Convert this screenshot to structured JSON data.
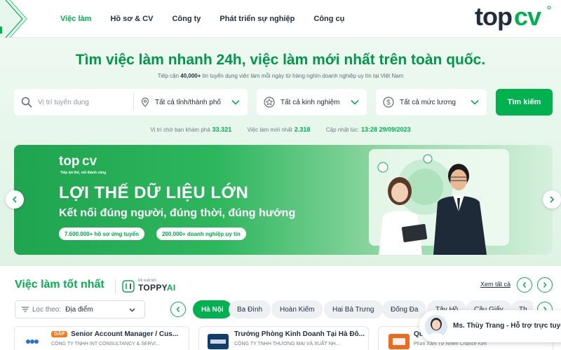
{
  "header": {
    "nav": [
      "Việc làm",
      "Hồ sơ & CV",
      "Công ty",
      "Phát triển sự nghiệp",
      "Công cụ"
    ],
    "logo_text": "topcv"
  },
  "hero": {
    "title": "Tìm việc làm nhanh 24h, việc làm mới nhất trên toàn quốc.",
    "subtitle_prefix": "Tiếp cận",
    "subtitle_count": "40,000+",
    "subtitle_rest": "tin tuyển dụng việc làm mỗi ngày từ hàng nghìn doanh nghiệp uy tín tại Việt Nam",
    "search": {
      "keyword_placeholder": "Vị trí tuyển dụng",
      "location": "Tất cả tỉnh/thành phố",
      "experience": "Tất cả kinh nghiệm",
      "salary": "Tất cả mức lương",
      "button": "Tìm kiếm"
    },
    "stats": {
      "waiting_label": "Vị trí chờ bạn khám phá",
      "waiting_value": "33.321",
      "new_label": "Việc làm mới nhất",
      "new_value": "2.318",
      "updated_label": "Cập nhật lúc:",
      "updated_value": "13:28 29/09/2023"
    }
  },
  "banner": {
    "logo": "topcv",
    "tagline": "Tiếp lợi thế, nối thành công",
    "headline": "LỢI THẾ DỮ LIỆU LỚN",
    "subheadline": "Kết nối đúng người, đúng thời, đúng hướng",
    "pill1": "7.600.000+ hồ sơ ứng tuyển",
    "pill2": "200.000+ doanh nghiệp uy tín"
  },
  "jobs": {
    "title": "Việc làm tốt nhất",
    "toppy_small": "Đề xuất bởi",
    "toppy_name": "TOPPY",
    "toppy_ai": "AI",
    "see_all": "Xem tất cả",
    "filter_label": "Lọc theo:",
    "filter_value": "Địa điểm",
    "chips": [
      "Hà Nội",
      "Ba Đình",
      "Hoàn Kiếm",
      "Hai Bà Trưng",
      "Đống Đa",
      "Tây Hồ",
      "Cầu Giấy",
      "Th"
    ],
    "cards": [
      {
        "badge": "GẤP",
        "title": "Senior Account Manager / Cus...",
        "company": "CÔNG TY TNHH INT CONSULTANCY & SERVI..."
      },
      {
        "badge": "",
        "title": "Trưởng Phòng Kinh Doanh Tại Hà Đô...",
        "company": "CÔNG TY TNHH THƯƠNG MẠI VÀ XUẤT NH..."
      },
      {
        "badge": "",
        "title": "Quản Trị Nhân Sự",
        "company": "Phan Xâm Tư Nhiên Chance Kim"
      }
    ]
  },
  "chat": {
    "text": "Ms. Thùy Trang - Hỗ trợ trực tuyến"
  },
  "colors": {
    "brand": "#00b14f",
    "text": "#212f3f",
    "hot": "#ff7a1a"
  }
}
